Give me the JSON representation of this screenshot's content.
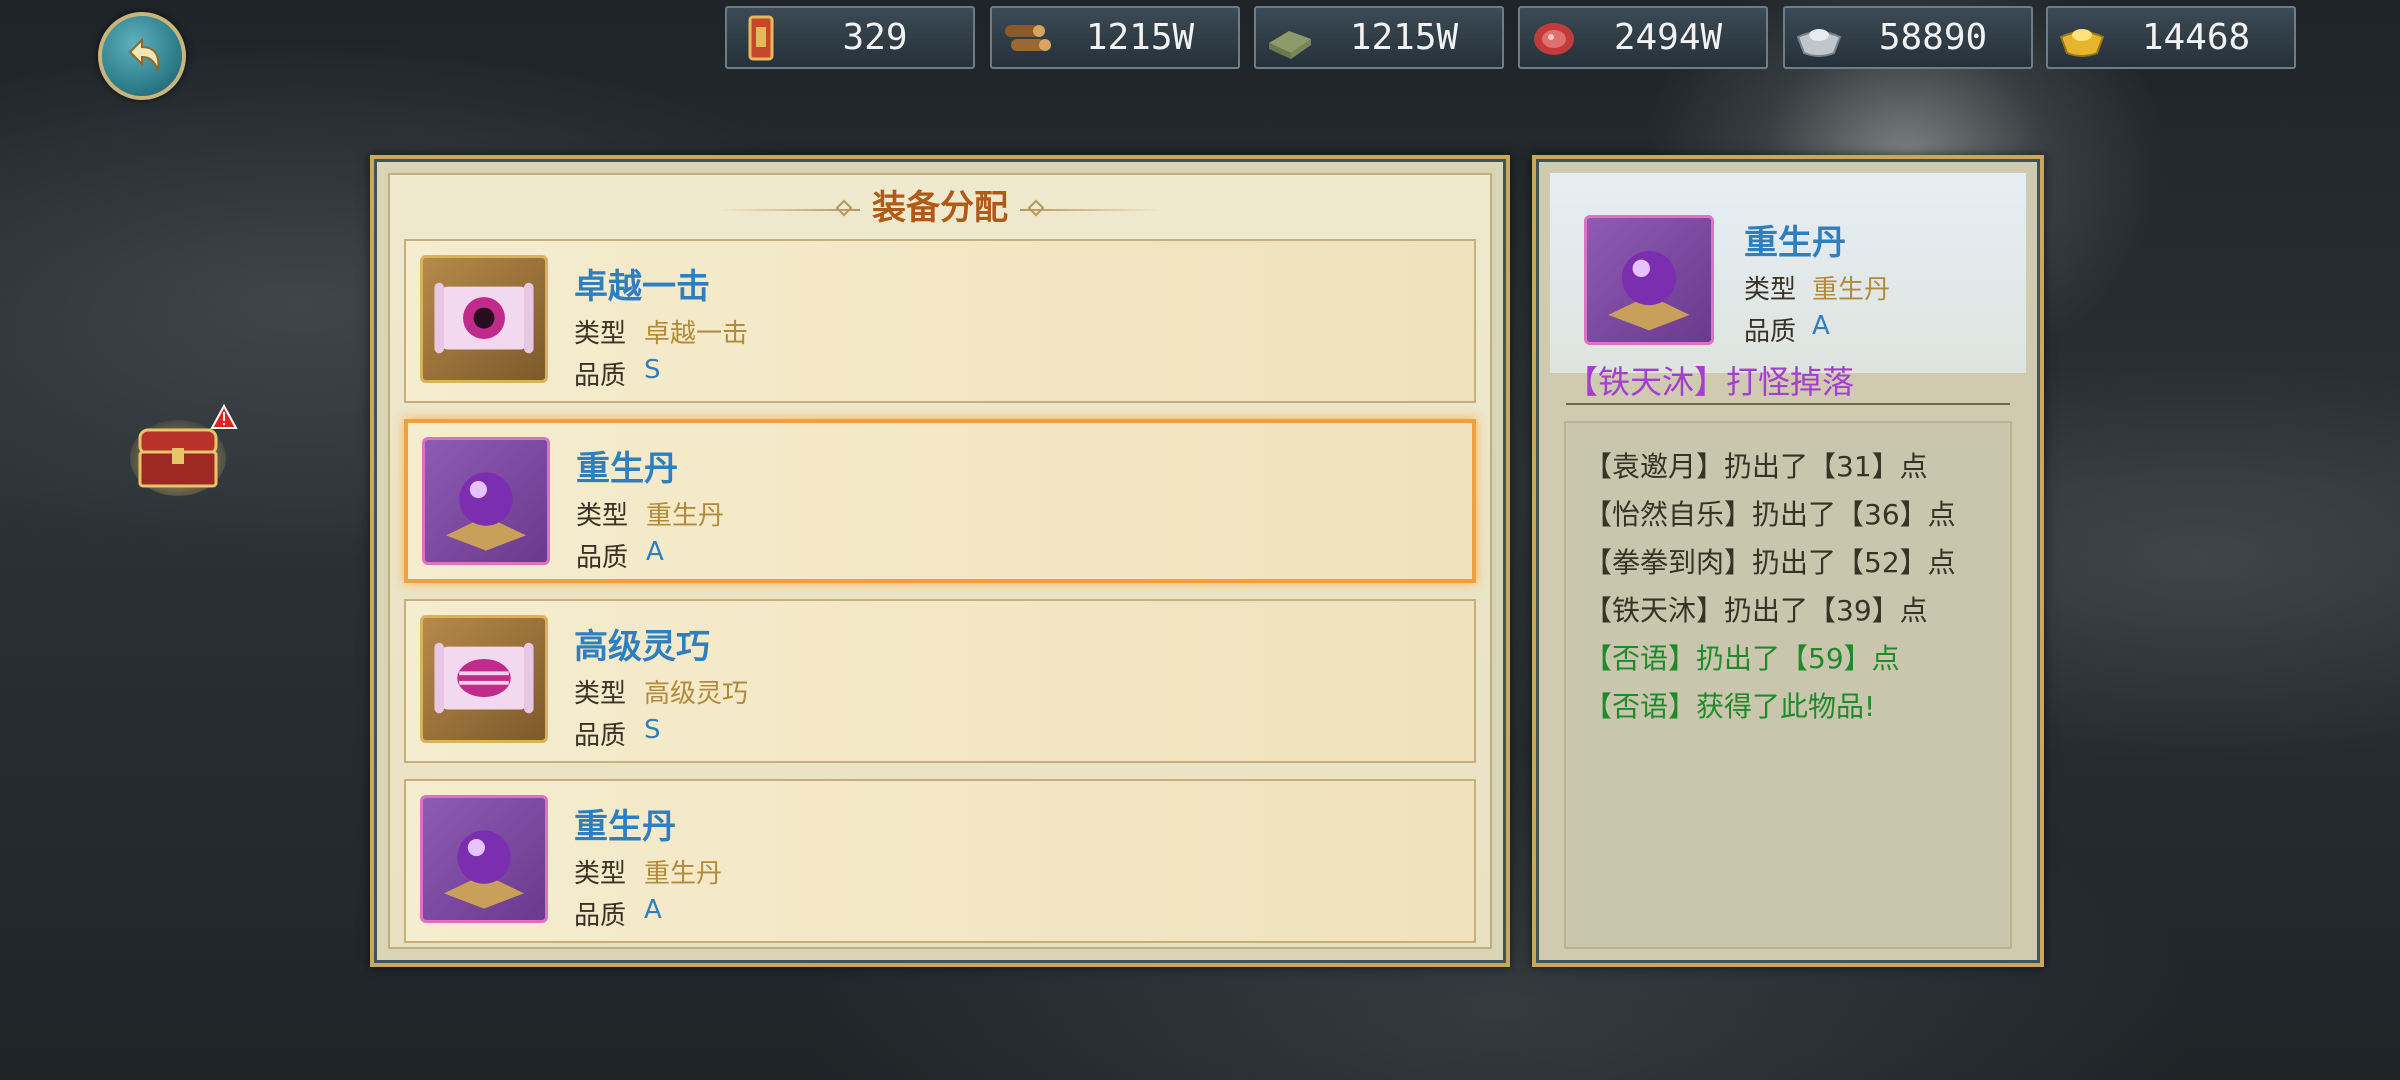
{
  "resources": [
    {
      "icon": "order-token-icon",
      "value": "329"
    },
    {
      "icon": "wood-logs-icon",
      "value": "1215W"
    },
    {
      "icon": "stone-slab-icon",
      "value": "1215W"
    },
    {
      "icon": "meat-icon",
      "value": "2494W"
    },
    {
      "icon": "silver-ingot-icon",
      "value": "58890"
    },
    {
      "icon": "gold-ingot-icon",
      "value": "14468"
    }
  ],
  "panel": {
    "title": "装备分配"
  },
  "items": [
    {
      "icon": "scroll-icon",
      "name": "卓越一击",
      "type_label": "类型",
      "type_value": "卓越一击",
      "quality_label": "品质",
      "quality_value": "S",
      "selected": false
    },
    {
      "icon": "purple-orb-icon",
      "name": "重生丹",
      "type_label": "类型",
      "type_value": "重生丹",
      "quality_label": "品质",
      "quality_value": "A",
      "selected": true
    },
    {
      "icon": "scroll-icon",
      "name": "高级灵巧",
      "type_label": "类型",
      "type_value": "高级灵巧",
      "quality_label": "品质",
      "quality_value": "S",
      "selected": false
    },
    {
      "icon": "purple-orb-icon",
      "name": "重生丹",
      "type_label": "类型",
      "type_value": "重生丹",
      "quality_label": "品质",
      "quality_value": "A",
      "selected": false
    }
  ],
  "detail": {
    "icon": "purple-orb-icon",
    "name": "重生丹",
    "type_label": "类型",
    "type_value": "重生丹",
    "quality_label": "品质",
    "quality_value": "A",
    "drop_source": "【铁天沐】打怪掉落",
    "log": [
      {
        "text": "【袁邀月】扔出了【31】点",
        "color": "#3a3226"
      },
      {
        "text": "【怡然自乐】扔出了【36】点",
        "color": "#3a3226"
      },
      {
        "text": "【拳拳到肉】扔出了【52】点",
        "color": "#3a3226"
      },
      {
        "text": "【铁天沐】扔出了【39】点",
        "color": "#3a3226"
      },
      {
        "text": "【否语】扔出了【59】点",
        "color": "#1f8a2a"
      },
      {
        "text": "【否语】获得了此物品!",
        "color": "#1f8a2a"
      }
    ]
  },
  "colors": {
    "name_blue": "#2d7fc0",
    "type_gold": "#b18a3a",
    "title_orange": "#b15a16",
    "drop_purple": "#a43ed0",
    "winner_green": "#1f8a2a"
  }
}
